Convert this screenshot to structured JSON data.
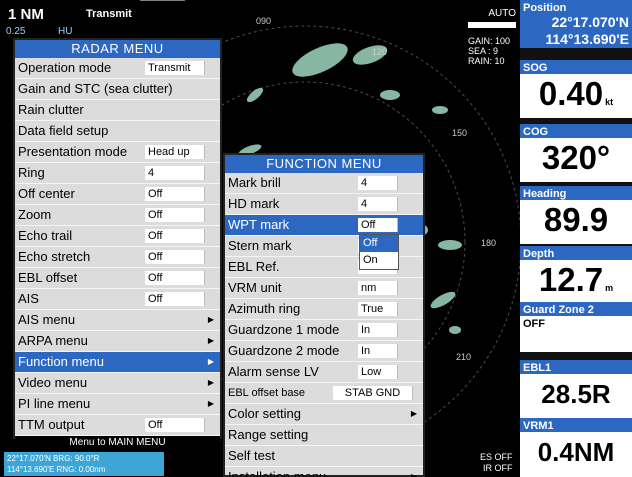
{
  "hud": {
    "range": "1 NM",
    "status": "Transmit",
    "range_sub": "0.25",
    "orientation": "HU",
    "auto": "AUTO",
    "gain_label": "GAIN: 100",
    "sea_label": "SEA :   9",
    "rain_label": "RAIN:  10",
    "es": "ES OFF",
    "ir": "IR OFF"
  },
  "bearing_labels": [
    "090",
    "120",
    "150",
    "180",
    "210"
  ],
  "cursor": {
    "line1": "22°17.070'N  BRG:  90.0°R",
    "line2": "114°13.690'E  RNG:  0.00nm"
  },
  "data_panel": {
    "position_title": "Position",
    "lat": "22°17.070'N",
    "lon": "114°13.690'E",
    "sog_title": "SOG",
    "sog": "0.40",
    "sog_unit": "kt",
    "cog_title": "COG",
    "cog": "320°",
    "heading_title": "Heading",
    "heading": "89.9",
    "depth_title": "Depth",
    "depth": "12.7",
    "depth_unit": "m",
    "gz_title": "Guard Zone 2",
    "gz_value": "OFF",
    "ebl_title": "EBL1",
    "ebl": "28.5R",
    "vrm_title": "VRM1",
    "vrm": "0.4NM"
  },
  "radar_menu": {
    "title": "RADAR MENU",
    "items": [
      {
        "label": "Operation mode",
        "value": "Transmit"
      },
      {
        "label": "Gain and STC (sea clutter)"
      },
      {
        "label": "Rain clutter"
      },
      {
        "label": "Data field setup"
      },
      {
        "label": "Presentation mode",
        "value": "Head up"
      },
      {
        "label": "Ring",
        "value": "4"
      },
      {
        "label": "Off center",
        "value": "Off"
      },
      {
        "label": "Zoom",
        "value": "Off"
      },
      {
        "label": "Echo trail",
        "value": "Off"
      },
      {
        "label": "Echo stretch",
        "value": "Off"
      },
      {
        "label": "EBL offset",
        "value": "Off"
      },
      {
        "label": "AIS",
        "value": "Off"
      },
      {
        "label": "AIS menu",
        "arrow": "▶"
      },
      {
        "label": "ARPA menu",
        "arrow": "▶"
      },
      {
        "label": "Function menu",
        "arrow": "▶"
      },
      {
        "label": "Video menu",
        "arrow": "▶"
      },
      {
        "label": "PI line menu",
        "arrow": "▶"
      },
      {
        "label": "TTM output",
        "value": "Off"
      }
    ],
    "footer": "Menu to MAIN MENU"
  },
  "function_menu": {
    "title": "FUNCTION MENU",
    "items": [
      {
        "label": "Mark brill",
        "value": "4"
      },
      {
        "label": "HD mark",
        "value": "4"
      },
      {
        "label": "WPT mark",
        "value": "Off"
      },
      {
        "label": "Stern mark",
        "value": ""
      },
      {
        "label": "EBL Ref.",
        "value": ""
      },
      {
        "label": "VRM unit",
        "value": "nm"
      },
      {
        "label": "Azimuth ring",
        "value": "True"
      },
      {
        "label": "Guardzone 1 mode",
        "value": "In"
      },
      {
        "label": "Guardzone 2 mode",
        "value": "In"
      },
      {
        "label": "Alarm sense LV",
        "value": "Low"
      },
      {
        "label": "EBL offset base",
        "value": "STAB GND"
      },
      {
        "label": "Color setting",
        "arrow": "▶"
      },
      {
        "label": "Range setting"
      },
      {
        "label": "Self test"
      },
      {
        "label": "Installation menu",
        "arrow": "▶"
      }
    ]
  },
  "dropdown": {
    "options": [
      "Off",
      "On"
    ]
  }
}
